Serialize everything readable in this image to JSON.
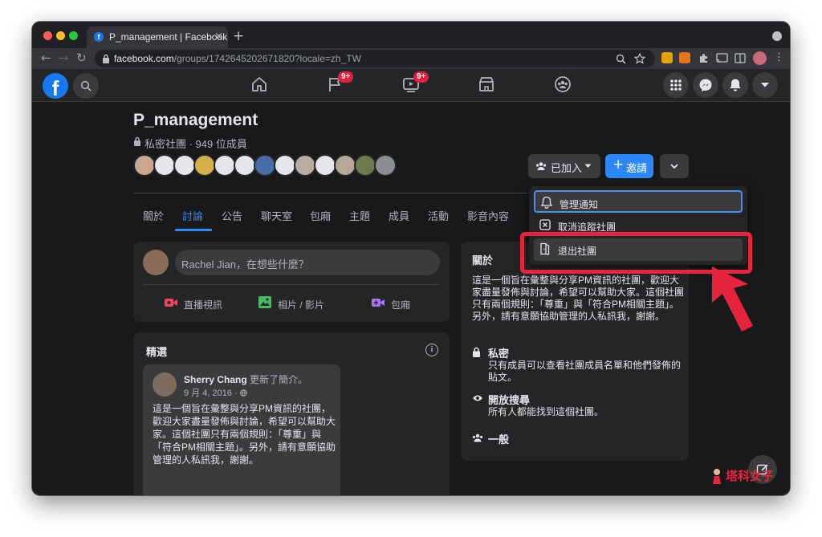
{
  "browser": {
    "tab_title": "P_management | Facebook",
    "tab_favicon": "f",
    "new_tab_label": "+",
    "close_tab_label": "×",
    "url_domain": "facebook.com",
    "url_path": "/groups/1742645202671820?locale=zh_TW",
    "traffic_lights": [
      "#ff5f57",
      "#febc2e",
      "#28c840"
    ]
  },
  "fb_header": {
    "logo": "f",
    "notifications_badge": "9+",
    "watch_badge": "9+",
    "icons": [
      "search-icon",
      "home-icon",
      "flag-icon",
      "video-icon",
      "marketplace-icon",
      "groups-icon",
      "menu-grid-icon",
      "messenger-icon",
      "bell-icon",
      "account-chevron-icon"
    ]
  },
  "group": {
    "name": "P_management",
    "privacy_and_members": "私密社團 · 949 位成員",
    "joined_button": "已加入",
    "invite_button": "邀請",
    "tabs": [
      "關於",
      "討論",
      "公告",
      "聊天室",
      "包廂",
      "主題",
      "成員",
      "活動",
      "影音內容"
    ],
    "active_tab": "討論"
  },
  "dropdown": {
    "items": [
      "管理通知",
      "取消追蹤社團",
      "退出社團"
    ],
    "highlighted": "退出社團"
  },
  "composer": {
    "placeholder": "Rachel Jian，在想些什麼？",
    "actions": [
      "直播視訊",
      "相片 / 影片",
      "包廂"
    ]
  },
  "featured": {
    "title": "精選",
    "post_author": "Sherry Chang",
    "post_action": "更新了簡介。",
    "post_date": "9 月 4, 2016 · ",
    "post_body": "這是一個旨在彙整與分享PM資訊的社團，歡迎大家盡量發佈與討論，希望可以幫助大家。這個社團只有兩個規則：「尊重」與「符合PM相關主題」。另外，請有意願協助管理的人私訊我，謝謝。"
  },
  "about": {
    "title": "關於",
    "description": "這是一個旨在彙整與分享PM資訊的社團，歡迎大家盡量發佈與討論，希望可以幫助大家。這個社團只有兩個規則：「尊重」與「符合PM相關主題」。另外，請有意願協助管理的人私訊我，謝謝。",
    "private_title": "私密",
    "private_desc": "只有成員可以查看社團成員名單和他們發佈的貼文。",
    "visible_title": "開放搜尋",
    "visible_desc": "所有人都能找到這個社團。",
    "general_title": "一般"
  },
  "watermark": "塔科女子",
  "colors": {
    "accent": "#2d88ff",
    "highlight": "#e8243c",
    "background": "#18191a",
    "card": "#242526"
  }
}
